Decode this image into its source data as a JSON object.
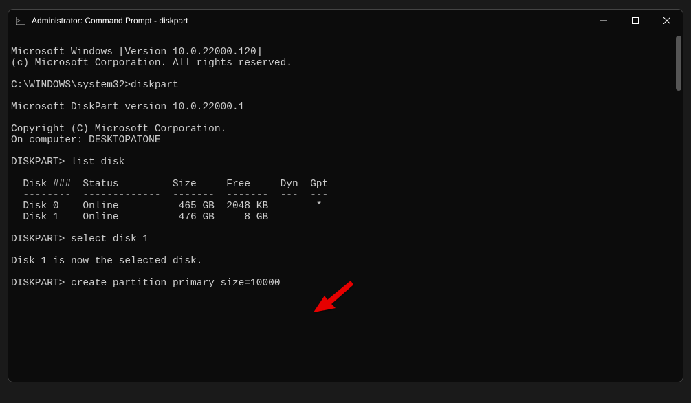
{
  "window": {
    "title": "Administrator: Command Prompt - diskpart"
  },
  "terminal": {
    "line1": "Microsoft Windows [Version 10.0.22000.120]",
    "line2": "(c) Microsoft Corporation. All rights reserved.",
    "blank1": "",
    "prompt1": "C:\\WINDOWS\\system32>diskpart",
    "blank2": "",
    "diskpart_ver": "Microsoft DiskPart version 10.0.22000.1",
    "blank3": "",
    "copyright": "Copyright (C) Microsoft Corporation.",
    "computer": "On computer: DESKTOPATONE",
    "blank4": "",
    "dp_prompt1": "DISKPART> list disk",
    "blank5": "",
    "table_header": "  Disk ###  Status         Size     Free     Dyn  Gpt",
    "table_sep": "  --------  -------------  -------  -------  ---  ---",
    "disk0": "  Disk 0    Online          465 GB  2048 KB        *",
    "disk1": "  Disk 1    Online          476 GB     8 GB",
    "blank6": "",
    "dp_prompt2": "DISKPART> select disk 1",
    "blank7": "",
    "selected_msg": "Disk 1 is now the selected disk.",
    "blank8": "",
    "dp_prompt3": "DISKPART> create partition primary size=10000"
  }
}
